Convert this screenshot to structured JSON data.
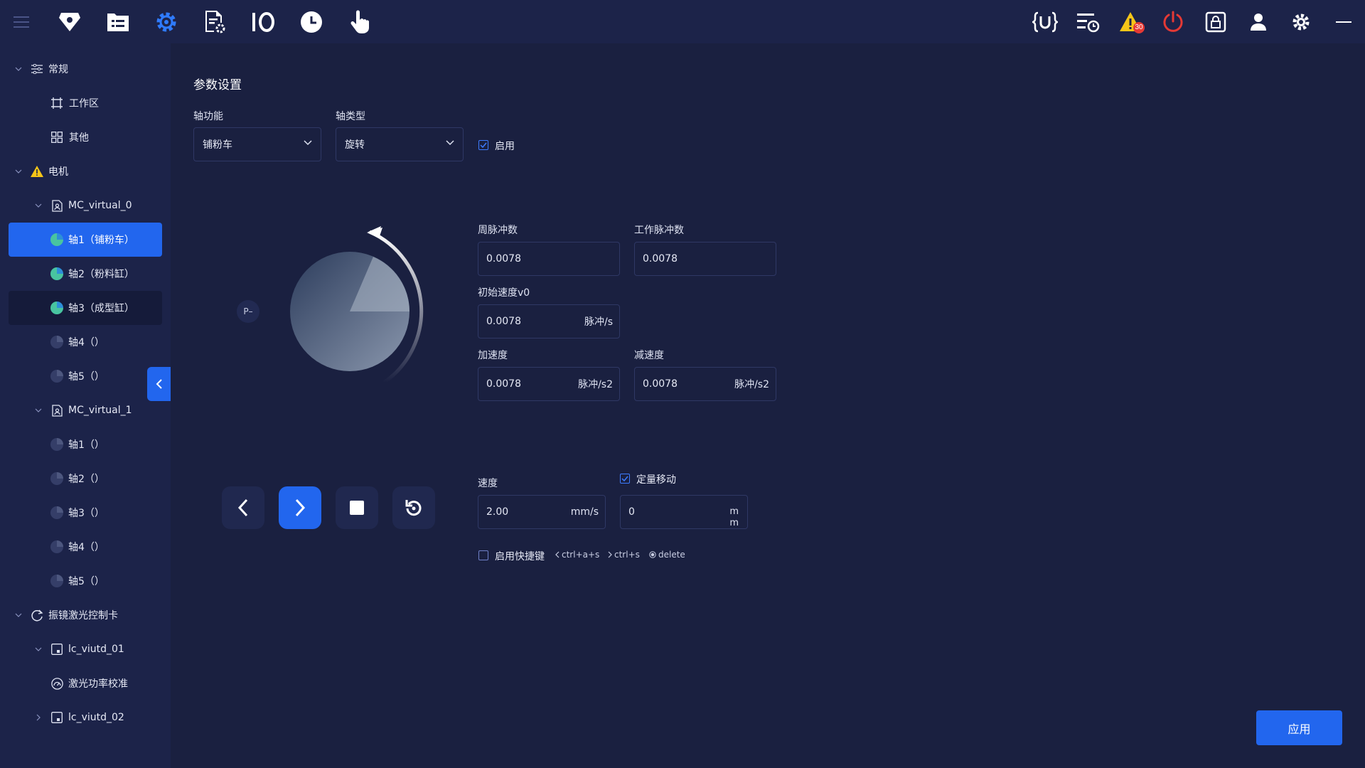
{
  "topbar": {
    "alarm_count": "30"
  },
  "sidebar": {
    "groups": {
      "general": "常规",
      "workspace": "工作区",
      "other": "其他",
      "motor": "电机",
      "mc0": "MC_virtual_0",
      "mc0_axis1": "轴1（铺粉车）",
      "mc0_axis2": "轴2（粉料缸）",
      "mc0_axis3": "轴3（成型缸）",
      "mc0_axis4": "轴4（）",
      "mc0_axis5": "轴5（）",
      "mc1": "MC_virtual_1",
      "mc1_axis1": "轴1（）",
      "mc1_axis2": "轴2（）",
      "mc1_axis3": "轴3（）",
      "mc1_axis4": "轴4（）",
      "mc1_axis5": "轴5（）",
      "galvo": "振镜激光控制卡",
      "lc1": "lc_viutd_01",
      "laser_cal": "激光功率校准",
      "lc2": "lc_viutd_02"
    }
  },
  "main": {
    "title": "参数设置",
    "axis_function_label": "轴功能",
    "axis_function_value": "铺粉车",
    "axis_type_label": "轴类型",
    "axis_type_value": "旋转",
    "enable_label": "启用",
    "rev_pulses_label": "周脉冲数",
    "rev_pulses_value": "0.0078",
    "work_pulses_label": "工作脉冲数",
    "work_pulses_value": "0.0078",
    "init_speed_label": "初始速度v0",
    "init_speed_value": "0.0078",
    "init_speed_unit": "脉冲/s",
    "accel_label": "加速度",
    "accel_value": "0.0078",
    "accel_unit": "脉冲/s2",
    "decel_label": "减速度",
    "decel_value": "0.0078",
    "decel_unit": "脉冲/s2",
    "speed_label": "速度",
    "speed_value": "2.00",
    "speed_unit": "mm/s",
    "fixed_move_label": "定量移动",
    "fixed_move_value": "0",
    "fixed_move_unit_1": "m",
    "fixed_move_unit_2": "m",
    "hotkey_enable_label": "启用快捷键",
    "hotkey_back": "ctrl+a+s",
    "hotkey_fwd": "ctrl+s",
    "hotkey_stop": "delete",
    "p_chip": "P–",
    "apply_label": "应用"
  },
  "colors": {
    "accent": "#2266ee",
    "background": "#1a2040",
    "panel": "#1c2349",
    "warning": "#f5c518",
    "power": "#e53935"
  },
  "icons": [
    "menu-icon",
    "diamond-shield-icon",
    "file-list-icon",
    "gear-icon",
    "file-settings-icon",
    "io-icon",
    "clock-icon",
    "hand-pointer-icon",
    "variable-icon",
    "schedule-list-icon",
    "warning-icon",
    "power-icon",
    "lock-icon",
    "user-icon",
    "settings-icon",
    "minimize-icon"
  ]
}
